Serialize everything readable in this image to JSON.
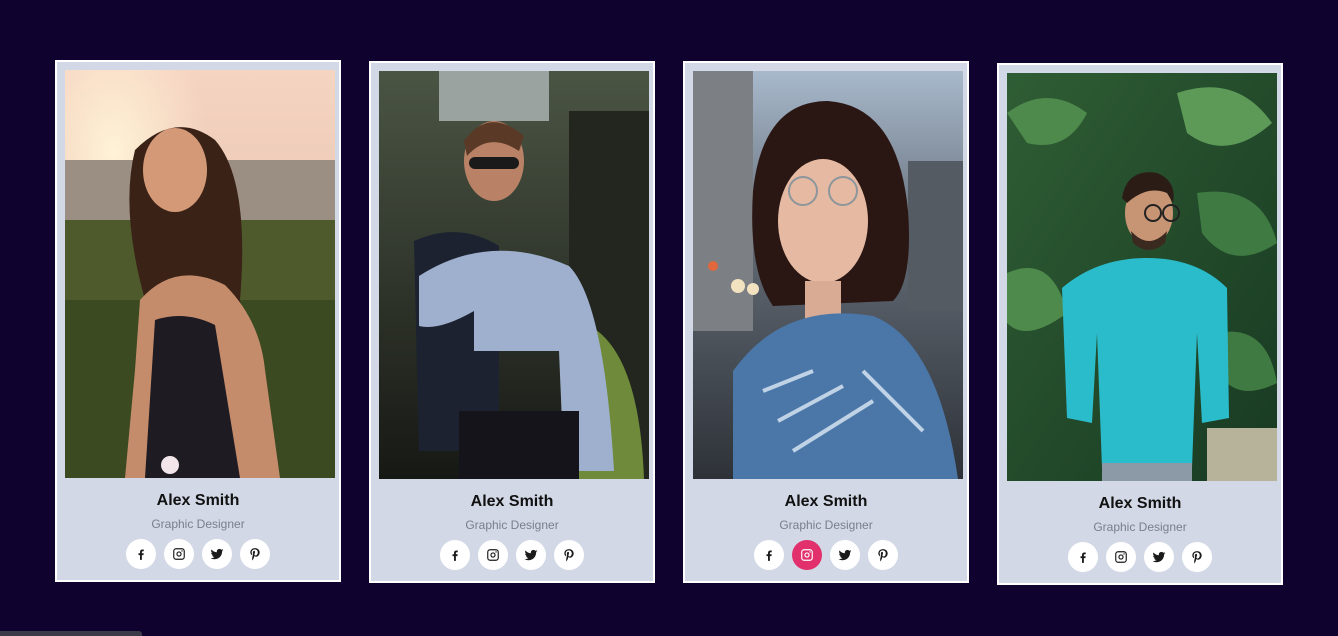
{
  "cards": [
    {
      "name": "Alex Smith",
      "role": "Graphic Designer",
      "photo": "woman-smiling-at-sunset-photo",
      "active_social": "none"
    },
    {
      "name": "Alex Smith",
      "role": "Graphic Designer",
      "photo": "man-in-sunglasses-blue-shirt-photo",
      "active_social": "none"
    },
    {
      "name": "Alex Smith",
      "role": "Graphic Designer",
      "photo": "woman-with-glasses-striped-shirt-photo",
      "active_social": "instagram"
    },
    {
      "name": "Alex Smith",
      "role": "Graphic Designer",
      "photo": "man-in-teal-shirt-by-plants-photo",
      "active_social": "none"
    }
  ],
  "social_icons": [
    "facebook-icon",
    "instagram-icon",
    "twitter-icon",
    "pinterest-icon"
  ],
  "colors": {
    "page_background": "#10022e",
    "card_background": "#d2d8e6",
    "card_border": "#ffffff",
    "social_button": "#ffffff",
    "social_active": "#e1306c",
    "role_text": "#7b7f8b"
  }
}
